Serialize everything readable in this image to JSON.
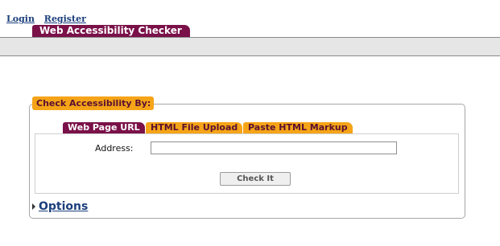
{
  "nav": {
    "login": "Login",
    "register": "Register"
  },
  "brand": {
    "title": "Web Accessibility Checker"
  },
  "form": {
    "legend": "Check Accessibility By:",
    "tabs": [
      {
        "label": "Web Page URL",
        "active": true
      },
      {
        "label": "HTML File Upload",
        "active": false
      },
      {
        "label": "Paste HTML Markup",
        "active": false
      }
    ],
    "address_label": "Address:",
    "address_value": "",
    "check_button": "Check It"
  },
  "options": {
    "label": "Options"
  },
  "colors": {
    "brand_maroon": "#7a1149",
    "accent_orange": "#f5a418",
    "link_blue": "#1c3f7c",
    "header_gray": "#e6e6e6"
  }
}
